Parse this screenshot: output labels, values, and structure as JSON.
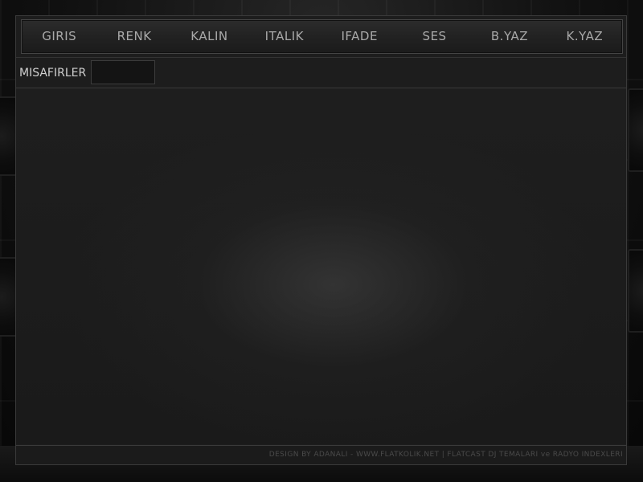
{
  "nav": {
    "items": [
      {
        "label": "GIRIS"
      },
      {
        "label": "RENK"
      },
      {
        "label": "KALIN"
      },
      {
        "label": "ITALIK"
      },
      {
        "label": "IFADE"
      },
      {
        "label": "SES"
      },
      {
        "label": "B.YAZ"
      },
      {
        "label": "K.YAZ"
      }
    ]
  },
  "guests": {
    "label": "MISAFIRLER",
    "value": ""
  },
  "footer": {
    "credit": "DESIGN BY ADANALI - WWW.FLATKOLIK.NET | FLATCAST DJ TEMALARI ve RADYO INDEXLERI"
  },
  "colors": {
    "background": "#0b0b0b",
    "panel": "#1d1d1d",
    "border": "#3a3a3a",
    "nav_text": "#a9a9a9",
    "label_text": "#cfcfcf",
    "footer_text": "#4a4a4a"
  }
}
